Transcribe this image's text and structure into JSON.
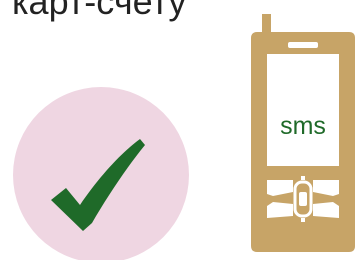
{
  "caption": "карт-счету",
  "badge": {
    "icon": "checkmark-icon",
    "circle_color": "#efd6e2",
    "check_color": "#1f6a29"
  },
  "phone": {
    "icon": "mobile-phone-icon",
    "body_color": "#c7a467",
    "screen_color": "#ffffff",
    "screen_text": "sms",
    "screen_text_color": "#1f6a29"
  }
}
